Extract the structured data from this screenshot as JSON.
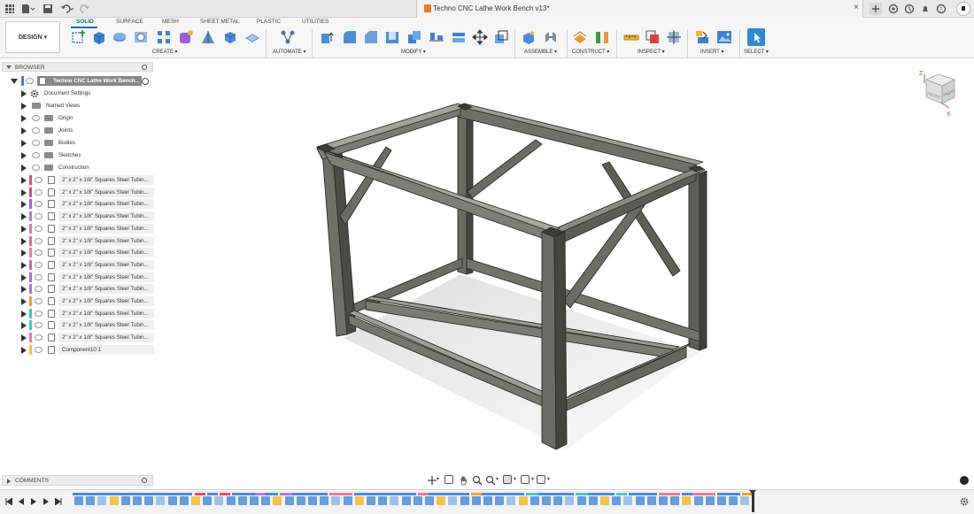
{
  "window": {
    "document_title": "Techno CNC Lathe Work Bench v13*"
  },
  "workspace": {
    "mode_label": "DESIGN",
    "tabs": [
      {
        "label": "SOLID",
        "active": true
      },
      {
        "label": "SURFACE",
        "active": false
      },
      {
        "label": "MESH",
        "active": false
      },
      {
        "label": "SHEET METAL",
        "active": false
      },
      {
        "label": "PLASTIC",
        "active": false
      },
      {
        "label": "UTILITIES",
        "active": false
      }
    ],
    "groups": [
      {
        "label": "CREATE ▾"
      },
      {
        "label": "AUTOMATE ▾"
      },
      {
        "label": "MODIFY ▾"
      },
      {
        "label": "ASSEMBLE ▾"
      },
      {
        "label": "CONSTRUCT ▾"
      },
      {
        "label": "INSPECT ▾"
      },
      {
        "label": "INSERT ▾"
      },
      {
        "label": "SELECT ▾"
      }
    ]
  },
  "browser": {
    "header": "BROWSER",
    "root": "Techno CNC Lathe Work Bench...",
    "items": [
      {
        "label": "Document Settings",
        "kind": "settings"
      },
      {
        "label": "Named Views",
        "kind": "folder"
      },
      {
        "label": "Origin",
        "kind": "folder"
      },
      {
        "label": "Joints",
        "kind": "folder"
      },
      {
        "label": "Bodies",
        "kind": "folder"
      },
      {
        "label": "Sketches",
        "kind": "folder"
      },
      {
        "label": "Construction",
        "kind": "folder"
      }
    ],
    "components": [
      {
        "label": "2\" x 2\" x 1/8\" Squares Steel Tubin...",
        "color": "#e84c6a"
      },
      {
        "label": "2\" x 2\" x 1/8\" Squares Steel Tubin...",
        "color": "#d24a8a"
      },
      {
        "label": "2\" x 2\" x 1/8\" Squares Steel Tubin...",
        "color": "#a066d0"
      },
      {
        "label": "2\" x 2\" x 1/8\" Squares Steel Tubin...",
        "color": "#b27ad8"
      },
      {
        "label": "2\" x 2\" x 1/8\" Squares Steel Tubin...",
        "color": "#d87aa8"
      },
      {
        "label": "2\" x 2\" x 1/8\" Squares Steel Tubin...",
        "color": "#e06d8f"
      },
      {
        "label": "2\" x 2\" x 1/8\" Squares Steel Tubin...",
        "color": "#e87aa0"
      },
      {
        "label": "2\" x 2\" x 1/8\" Squares Steel Tubin...",
        "color": "#cf6aa0"
      },
      {
        "label": "2\" x 2\" x 1/8\" Squares Steel Tubin...",
        "color": "#9b6fd8"
      },
      {
        "label": "2\" x 2\" x 1/8\" Squares Steel Tubin...",
        "color": "#a876d5"
      },
      {
        "label": "2\" x 2\" x 1/8\" Squares Steel Tubin...",
        "color": "#f0a030"
      },
      {
        "label": "2\" x 2\" x 1/8\" Squares Steel Tubin...",
        "color": "#3fc7c0"
      },
      {
        "label": "2\" x 2\" x 1/8\" Squares Steel Tubin...",
        "color": "#46c8d0"
      },
      {
        "label": "2\" x 2\" x 1/8\" Squares Steel Tubin...",
        "color": "#e87aa0"
      },
      {
        "label": "Component10:1",
        "color": "#f2c23c"
      }
    ]
  },
  "comments": {
    "header": "COMMENTS"
  },
  "viewcube": {
    "front": "FRONT",
    "right": "RIGHT",
    "axis_z": "Z",
    "axis_x": "X"
  },
  "colors": {
    "accent": "#0f6fc6",
    "frame_steel": "#5f6058",
    "frame_steel_light": "#8a8b82",
    "frame_steel_dark": "#3d3e38"
  }
}
